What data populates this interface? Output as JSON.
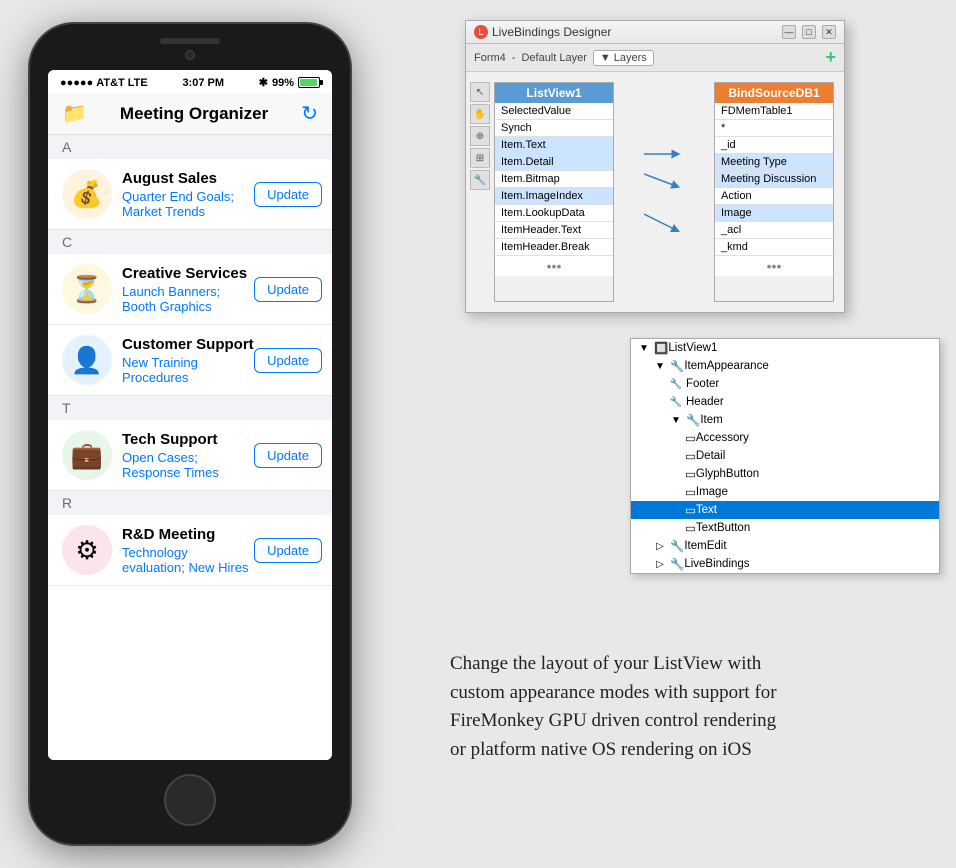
{
  "phone": {
    "status": {
      "carrier": "AT&T",
      "network": "LTE",
      "time": "3:07 PM",
      "battery": "99%"
    },
    "nav": {
      "title": "Meeting Organizer",
      "refresh_icon": "↻"
    },
    "sections": [
      {
        "letter": "A",
        "items": [
          {
            "id": "august-sales",
            "title": "August Sales",
            "detail": "Quarter End Goals; Market Trends",
            "button": "Update",
            "icon": "💰",
            "icon_class": "sales"
          }
        ]
      },
      {
        "letter": "C",
        "items": [
          {
            "id": "creative-services",
            "title": "Creative Services",
            "detail": "Launch Banners; Booth Graphics",
            "button": "Update",
            "icon": "⏳",
            "icon_class": "creative"
          },
          {
            "id": "customer-support",
            "title": "Customer Support",
            "detail": "New Training Procedures",
            "button": "Update",
            "icon": "👤",
            "icon_class": "support"
          }
        ]
      },
      {
        "letter": "T",
        "items": [
          {
            "id": "tech-support",
            "title": "Tech Support",
            "detail": "Open Cases; Response Times",
            "button": "Update",
            "icon": "💼",
            "icon_class": "tech"
          }
        ]
      },
      {
        "letter": "R",
        "items": [
          {
            "id": "rd-meeting",
            "title": "R&D Meeting",
            "detail": "Technology evaluation; New Hires",
            "button": "Update",
            "icon": "⚙",
            "icon_class": "rd"
          }
        ]
      }
    ]
  },
  "designer": {
    "title": "LiveBindings Designer",
    "form": "Form4",
    "layer": "Default Layer",
    "layers_btn": "Layers",
    "add_icon": "+",
    "listview_table": {
      "header": "ListView1",
      "rows": [
        "SelectedValue",
        "Synch",
        "Item.Text",
        "Item.Detail",
        "Item.Bitmap",
        "Item.ImageIndex",
        "Item.LookupData",
        "ItemHeader.Text",
        "ItemHeader.Break"
      ]
    },
    "bindsource_table": {
      "header": "BindSourceDB1",
      "rows": [
        "FDMemTable1",
        "*",
        "_id",
        "Meeting Type",
        "Meeting Discussion",
        "Action",
        "Image",
        "_acl",
        "_kmd"
      ]
    }
  },
  "tree": {
    "items": [
      {
        "label": "ListView1",
        "indent": 0,
        "icon": "🔲",
        "expanded": true
      },
      {
        "label": "ItemAppearance",
        "indent": 1,
        "icon": "🔧",
        "expanded": false
      },
      {
        "label": "Footer",
        "indent": 2,
        "icon": "🔧",
        "expanded": false
      },
      {
        "label": "Header",
        "indent": 2,
        "icon": "🔧",
        "expanded": false
      },
      {
        "label": "Item",
        "indent": 2,
        "icon": "🔧",
        "expanded": true
      },
      {
        "label": "Accessory",
        "indent": 3,
        "icon": "▭"
      },
      {
        "label": "Detail",
        "indent": 3,
        "icon": "▭"
      },
      {
        "label": "GlyphButton",
        "indent": 3,
        "icon": "▭"
      },
      {
        "label": "Image",
        "indent": 3,
        "icon": "▭"
      },
      {
        "label": "Text",
        "indent": 3,
        "icon": "▭",
        "selected": true
      },
      {
        "label": "TextButton",
        "indent": 3,
        "icon": "▭"
      },
      {
        "label": "ItemEdit",
        "indent": 1,
        "icon": "🔧",
        "expanded": false
      },
      {
        "label": "LiveBindings",
        "indent": 1,
        "icon": "🔧",
        "expanded": false
      }
    ]
  },
  "description": "Change the layout of your ListView with\ncustom appearance modes with support for\nFireMonkey GPU driven control rendering\nor platform native OS rendering on iOS"
}
